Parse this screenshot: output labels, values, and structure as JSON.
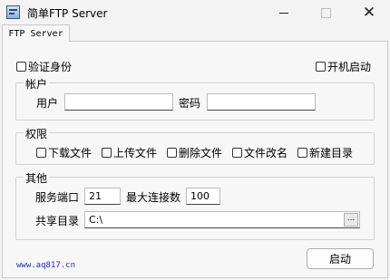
{
  "window": {
    "title": "简单FTP Server"
  },
  "tabs": [
    {
      "label": "FTP Server"
    }
  ],
  "auth": {
    "verify_label": "验证身份",
    "autostart_label": "开机启动"
  },
  "account": {
    "group_label": "帐户",
    "user_label": "用户",
    "user_value": "",
    "password_label": "密码",
    "password_value": ""
  },
  "permissions": {
    "group_label": "权限",
    "items": [
      {
        "label": "下载文件"
      },
      {
        "label": "上传文件"
      },
      {
        "label": "删除文件"
      },
      {
        "label": "文件改名"
      },
      {
        "label": "新建目录"
      }
    ]
  },
  "other": {
    "group_label": "其他",
    "port_label": "服务端口",
    "port_value": "21",
    "max_conn_label": "最大连接数",
    "max_conn_value": "100",
    "share_dir_label": "共享目录",
    "share_dir_value": "C:\\",
    "browse_label": "..."
  },
  "footer": {
    "link_text": "www.aq817.cn",
    "start_label": "启动"
  },
  "icons": {
    "app": "ftp-app-icon",
    "minimize": "minimize-icon",
    "maximize": "maximize-icon",
    "close": "close-icon"
  }
}
